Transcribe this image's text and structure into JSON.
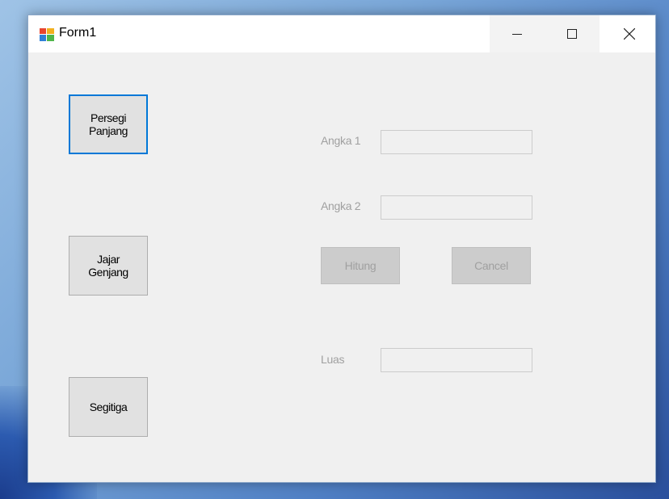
{
  "window": {
    "title": "Form1",
    "caption_buttons": [
      "minimize-icon",
      "maximize-icon",
      "close-icon"
    ]
  },
  "shape_buttons": [
    {
      "label": "Persegi\nPanjang",
      "focused": true
    },
    {
      "label": "Jajar\nGenjang",
      "focused": false
    },
    {
      "label": "Segitiga",
      "focused": false
    }
  ],
  "form": {
    "angka1_label": "Angka 1",
    "angka1_value": "",
    "angka2_label": "Angka 2",
    "angka2_value": "",
    "hitung_label": "Hitung",
    "cancel_label": "Cancel",
    "luas_label": "Luas",
    "luas_value": ""
  },
  "colors": {
    "focus_border": "#0078d7",
    "disabled_text": "#a0a0a0"
  }
}
